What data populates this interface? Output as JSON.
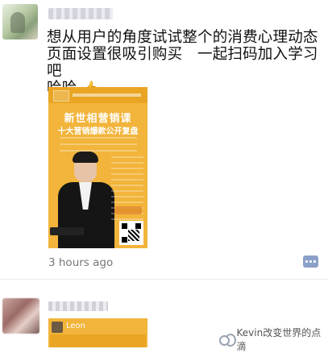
{
  "post1": {
    "text_line1": "想从用户的角度试试整个的消费心理动态",
    "text_line2": "页面设置很吸引购买　一起扫码加入学习吧",
    "text_line3": "哈哈",
    "emoji": "👍",
    "poster": {
      "title": "新世相营销课",
      "subtitle": "十大营销爆款公开复盘"
    },
    "time": "3 hours ago"
  },
  "post2": {
    "poster_label": "Leon"
  },
  "watermark": {
    "text": "Kevin改变世界的点滴"
  }
}
